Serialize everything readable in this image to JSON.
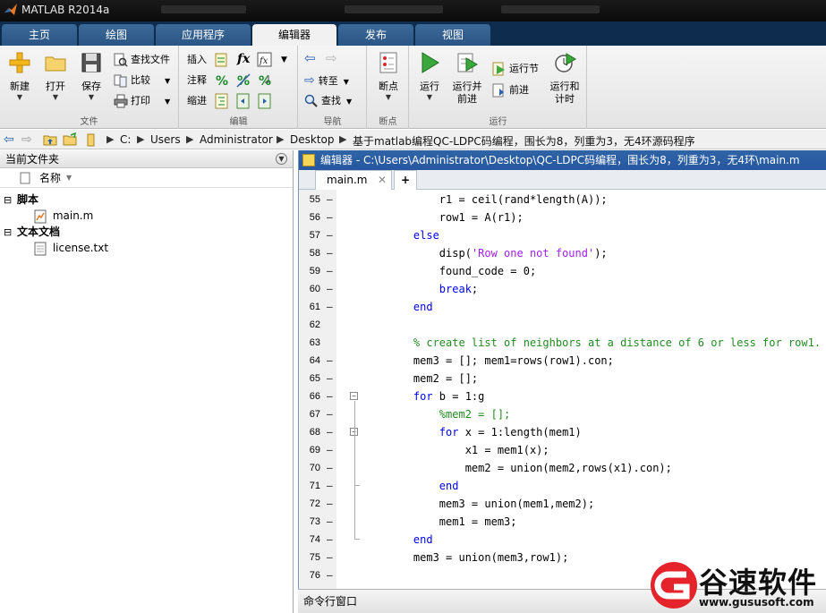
{
  "window": {
    "title": "MATLAB R2014a"
  },
  "ribbon_tabs": [
    {
      "label": "主页",
      "active": false
    },
    {
      "label": "绘图",
      "active": false
    },
    {
      "label": "应用程序",
      "active": false
    },
    {
      "label": "编辑器",
      "active": true
    },
    {
      "label": "发布",
      "active": false
    },
    {
      "label": "视图",
      "active": false
    }
  ],
  "ribbon": {
    "file": {
      "label": "文件",
      "new": "新建",
      "open": "打开",
      "save": "保存",
      "find_files": "查找文件",
      "compare": "比较",
      "print": "打印"
    },
    "edit": {
      "label": "编辑",
      "insert": "插入",
      "comment": "注释",
      "indent": "缩进",
      "fx": "fx"
    },
    "nav": {
      "label": "导航",
      "goto": "转至",
      "find": "查找"
    },
    "breakpoints": {
      "label": "断点",
      "breakpoint": "断点"
    },
    "run": {
      "label": "运行",
      "run": "运行",
      "run_advance_l1": "运行并",
      "run_advance_l2": "前进",
      "run_section": "运行节",
      "advance": "前进",
      "run_time_l1": "运行和",
      "run_time_l2": "计时"
    }
  },
  "address": {
    "crumbs": [
      "C:",
      "Users",
      "Administrator",
      "Desktop",
      "基于matlab编程QC-LDPC码编程，围长为8，列重为3，无4环源码程序"
    ]
  },
  "file_browser": {
    "title": "当前文件夹",
    "column_name": "名称",
    "groups": [
      {
        "label": "脚本",
        "files": [
          "main.m"
        ]
      },
      {
        "label": "文本文档",
        "files": [
          "license.txt"
        ]
      }
    ]
  },
  "editor": {
    "title": "编辑器 - C:\\Users\\Administrator\\Desktop\\QC-LDPC码编程，围长为8，列重为3，无4环\\main.m",
    "tab_label": "main.m",
    "add_tab": "+",
    "lines": [
      {
        "num": "55",
        "dash": true,
        "fold": "",
        "segments": [
          [
            "",
            "        r1 = ceil(rand*length(A));"
          ]
        ]
      },
      {
        "num": "56",
        "dash": true,
        "fold": "",
        "segments": [
          [
            "",
            "        row1 = A(r1);"
          ]
        ]
      },
      {
        "num": "57",
        "dash": true,
        "fold": "",
        "segments": [
          [
            "kw",
            "    else"
          ]
        ]
      },
      {
        "num": "58",
        "dash": true,
        "fold": "",
        "segments": [
          [
            "",
            "        disp("
          ],
          [
            "str",
            "'Row one not found'"
          ],
          [
            "",
            ");"
          ]
        ]
      },
      {
        "num": "59",
        "dash": true,
        "fold": "",
        "segments": [
          [
            "",
            "        found_code = 0;"
          ]
        ]
      },
      {
        "num": "60",
        "dash": true,
        "fold": "",
        "segments": [
          [
            "kw",
            "        break"
          ],
          [
            "",
            ";"
          ]
        ]
      },
      {
        "num": "61",
        "dash": true,
        "fold": "",
        "segments": [
          [
            "kw",
            "    end"
          ]
        ]
      },
      {
        "num": "62",
        "dash": false,
        "fold": "",
        "segments": [
          [
            "",
            ""
          ]
        ]
      },
      {
        "num": "63",
        "dash": false,
        "fold": "",
        "segments": [
          [
            "cmt",
            "    % create list of neighbors at a distance of 6 or less for row1."
          ]
        ]
      },
      {
        "num": "64",
        "dash": true,
        "fold": "",
        "segments": [
          [
            "",
            "    mem3 = []; mem1=rows(row1).con;"
          ]
        ]
      },
      {
        "num": "65",
        "dash": true,
        "fold": "",
        "segments": [
          [
            "",
            "    mem2 = [];"
          ]
        ]
      },
      {
        "num": "66",
        "dash": true,
        "fold": "box",
        "segments": [
          [
            "kw",
            "    for"
          ],
          [
            "",
            " b = 1:g"
          ]
        ]
      },
      {
        "num": "67",
        "dash": true,
        "fold": "",
        "segments": [
          [
            "cmt",
            "        %mem2 = [];"
          ]
        ]
      },
      {
        "num": "68",
        "dash": true,
        "fold": "box",
        "segments": [
          [
            "kw",
            "        for"
          ],
          [
            "",
            " x = 1:length(mem1)"
          ]
        ]
      },
      {
        "num": "69",
        "dash": true,
        "fold": "",
        "segments": [
          [
            "",
            "            x1 = mem1(x);"
          ]
        ]
      },
      {
        "num": "70",
        "dash": true,
        "fold": "",
        "segments": [
          [
            "",
            "            mem2 = union(mem2,rows(x1).con);"
          ]
        ]
      },
      {
        "num": "71",
        "dash": true,
        "fold": "end",
        "segments": [
          [
            "kw",
            "        end"
          ]
        ]
      },
      {
        "num": "72",
        "dash": true,
        "fold": "",
        "segments": [
          [
            "",
            "        mem3 = union(mem1,mem2);"
          ]
        ]
      },
      {
        "num": "73",
        "dash": true,
        "fold": "",
        "segments": [
          [
            "",
            "        mem1 = mem3;"
          ]
        ]
      },
      {
        "num": "74",
        "dash": true,
        "fold": "end",
        "segments": [
          [
            "kw",
            "    end"
          ]
        ]
      },
      {
        "num": "75",
        "dash": true,
        "fold": "",
        "segments": [
          [
            "",
            "    mem3 = union(mem3,row1);"
          ]
        ]
      },
      {
        "num": "76",
        "dash": true,
        "fold": "",
        "segments": [
          [
            "",
            ""
          ]
        ]
      }
    ]
  },
  "command_window": {
    "title": "命令行窗口"
  },
  "watermark": {
    "name": "谷速软件",
    "url": "www.gususoft.com",
    "color": "#e4242a"
  },
  "colors": {
    "keyword": "#0000ff",
    "string": "#a020f0",
    "comment": "#228b22",
    "tab_active_bg": "#f1f1f1",
    "tabbar_bg": "#0e2c4e"
  }
}
